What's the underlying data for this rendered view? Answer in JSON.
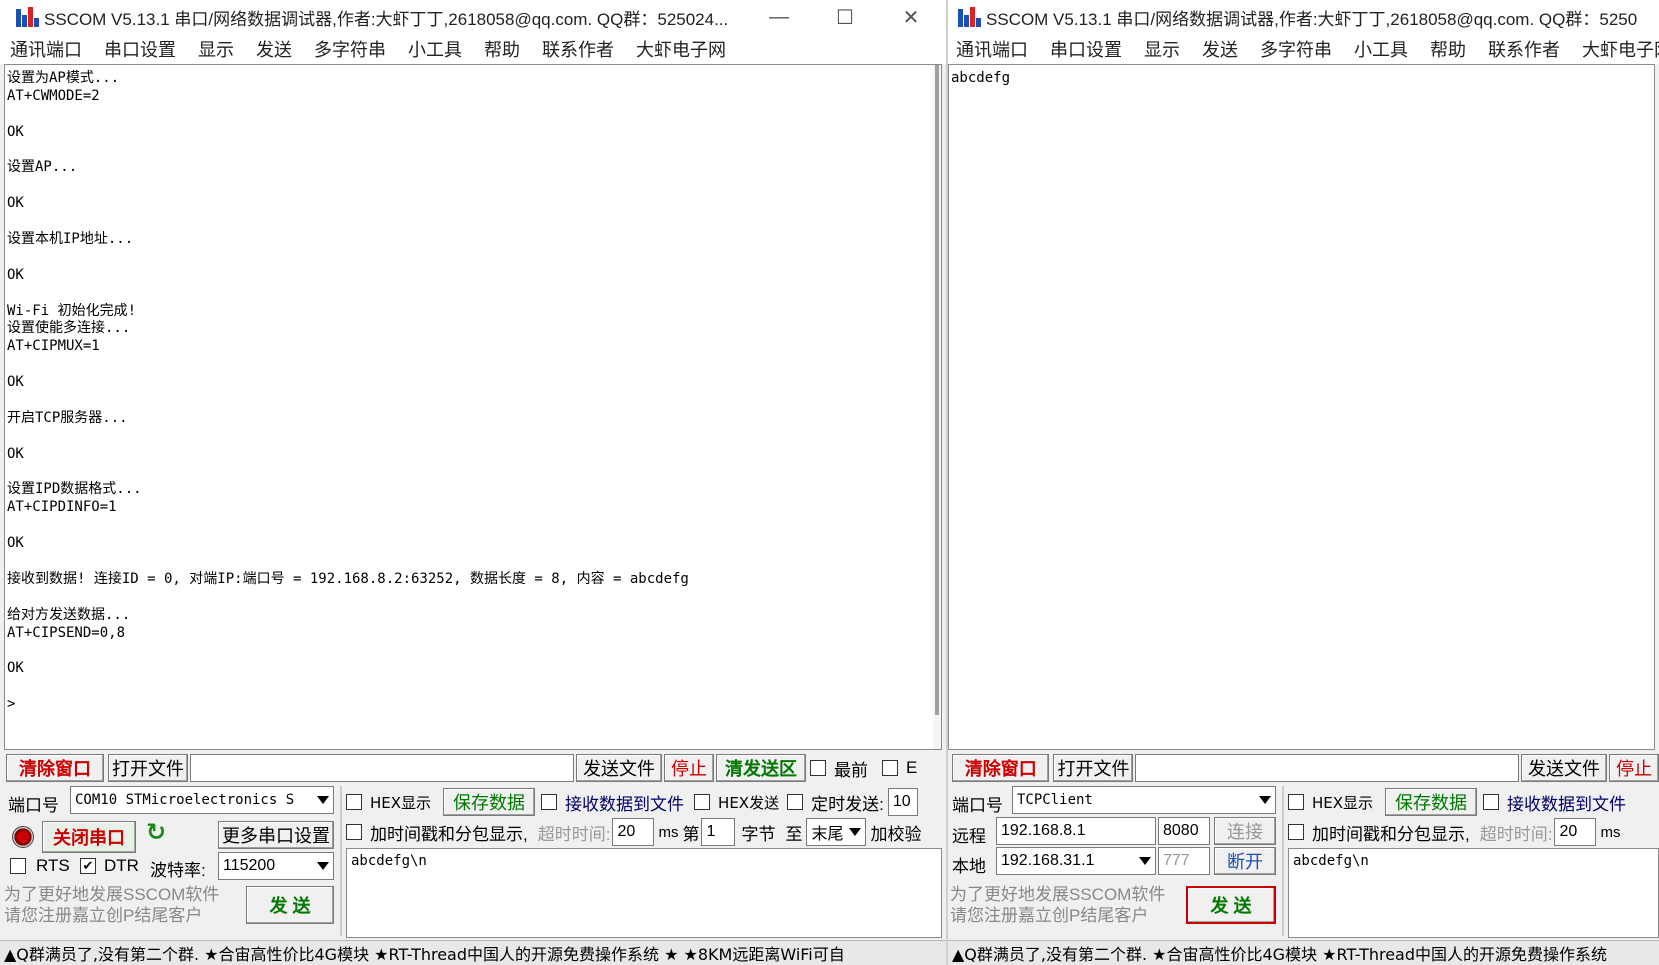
{
  "left": {
    "title": "SSCOM V5.13.1 串口/网络数据调试器,作者:大虾丁丁,2618058@qq.com. QQ群：525024...",
    "menu": [
      "通讯端口",
      "串口设置",
      "显示",
      "发送",
      "多字符串",
      "小工具",
      "帮助",
      "联系作者",
      "大虾电子网"
    ],
    "recv_lines": [
      "设置为AP模式...",
      "AT+CWMODE=2",
      "",
      "OK",
      "",
      "设置AP...",
      "",
      "OK",
      "",
      "设置本机IP地址...",
      "",
      "OK",
      "",
      "Wi-Fi 初始化完成!",
      "设置使能多连接...",
      "AT+CIPMUX=1",
      "",
      "OK",
      "",
      "开启TCP服务器...",
      "",
      "OK",
      "",
      "设置IPD数据格式...",
      "AT+CIPDINFO=1",
      "",
      "OK",
      "",
      "接收到数据! 连接ID = 0, 对端IP:端口号 = 192.168.8.2:63252, 数据长度 = 8, 内容 = abcdefg",
      "",
      "给对方发送数据...",
      "AT+CIPSEND=0,8",
      "",
      "OK",
      "",
      ">"
    ],
    "toolbar": {
      "clear": "清除窗口",
      "open_file": "打开文件",
      "send_file": "发送文件",
      "stop": "停止",
      "clear_send": "清发送区",
      "topmost": "最前",
      "trailing": "E"
    },
    "port_label": "端口号",
    "port_value": "COM10 STMicroelectronics S",
    "close_port": "关闭串口",
    "more_settings": "更多串口设置",
    "rts": "RTS",
    "dtr": "DTR",
    "baud_label": "波特率:",
    "baud_value": "115200",
    "hex_display": "HEX显示",
    "save_data": "保存数据",
    "recv_to_file": "接收数据到文件",
    "hex_send": "HEX发送",
    "timed_send": "定时发送:",
    "timed_value": "10",
    "timestamp": "加时间戳和分包显示,",
    "timeout_label": "超时时间:",
    "timeout_value": "20",
    "ms": "ms",
    "nth": "第",
    "nth_value": "1",
    "byte_label": "字节",
    "to_label": "至",
    "tail_value": "末尾",
    "checksum": "加校验",
    "send_text": "abcdefg\\n",
    "promo1": "为了更好地发展SSCOM软件",
    "promo2": "请您注册嘉立创P结尾客户",
    "send_btn": "发 送",
    "status": "▲Q群满员了,没有第二个群. ★合宙高性价比4G模块 ★RT-Thread中国人的开源免费操作系统 ★ ★8KM远距离WiFi可自"
  },
  "right": {
    "title": "SSCOM V5.13.1 串口/网络数据调试器,作者:大虾丁丁,2618058@qq.com. QQ群：5250",
    "menu": [
      "通讯端口",
      "串口设置",
      "显示",
      "发送",
      "多字符串",
      "小工具",
      "帮助",
      "联系作者",
      "大虾电子网"
    ],
    "recv_lines": [
      "abcdefg"
    ],
    "toolbar": {
      "clear": "清除窗口",
      "open_file": "打开文件",
      "send_file": "发送文件",
      "stop": "停止"
    },
    "port_label": "端口号",
    "port_value": "TCPClient",
    "remote_label": "远程",
    "remote_ip": "192.168.8.1",
    "remote_port": "8080",
    "connect": "连接",
    "local_label": "本地",
    "local_ip": "192.168.31.1",
    "local_port": "777",
    "disconnect": "断开",
    "hex_display": "HEX显示",
    "save_data": "保存数据",
    "recv_to_file": "接收数据到文件",
    "timestamp": "加时间戳和分包显示,",
    "timeout_label": "超时时间:",
    "timeout_value": "20",
    "ms": "ms",
    "send_text": "abcdefg\\n",
    "promo1": "为了更好地发展SSCOM软件",
    "promo2": "请您注册嘉立创P结尾客户",
    "send_btn": "发 送",
    "status": "▲Q群满员了,没有第二个群. ★合宙高性价比4G模块 ★RT-Thread中国人的开源免费操作系统"
  }
}
